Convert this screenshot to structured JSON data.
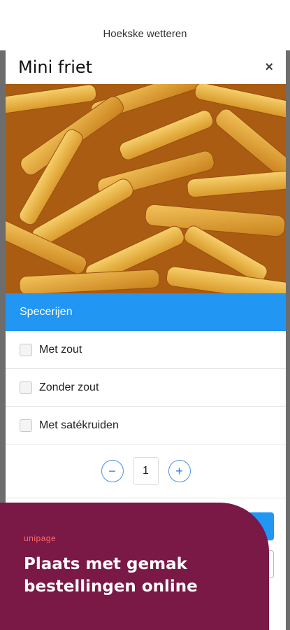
{
  "topbar": {
    "title": "Hoekske wetteren"
  },
  "modal": {
    "title": "Mini friet",
    "close_label": "×",
    "section_title": "Specerijen",
    "options": [
      "Met zout",
      "Zonder zout",
      "Met satékruiden"
    ],
    "quantity": "1",
    "minus": "−",
    "plus": "+"
  },
  "promo": {
    "logo": "unipage",
    "text_line1": "Plaats met gemak",
    "text_line2": "bestellingen online"
  },
  "colors": {
    "accent": "#2196f3",
    "promo_bg": "#7a1846",
    "backdrop": "#6d6d6d"
  }
}
